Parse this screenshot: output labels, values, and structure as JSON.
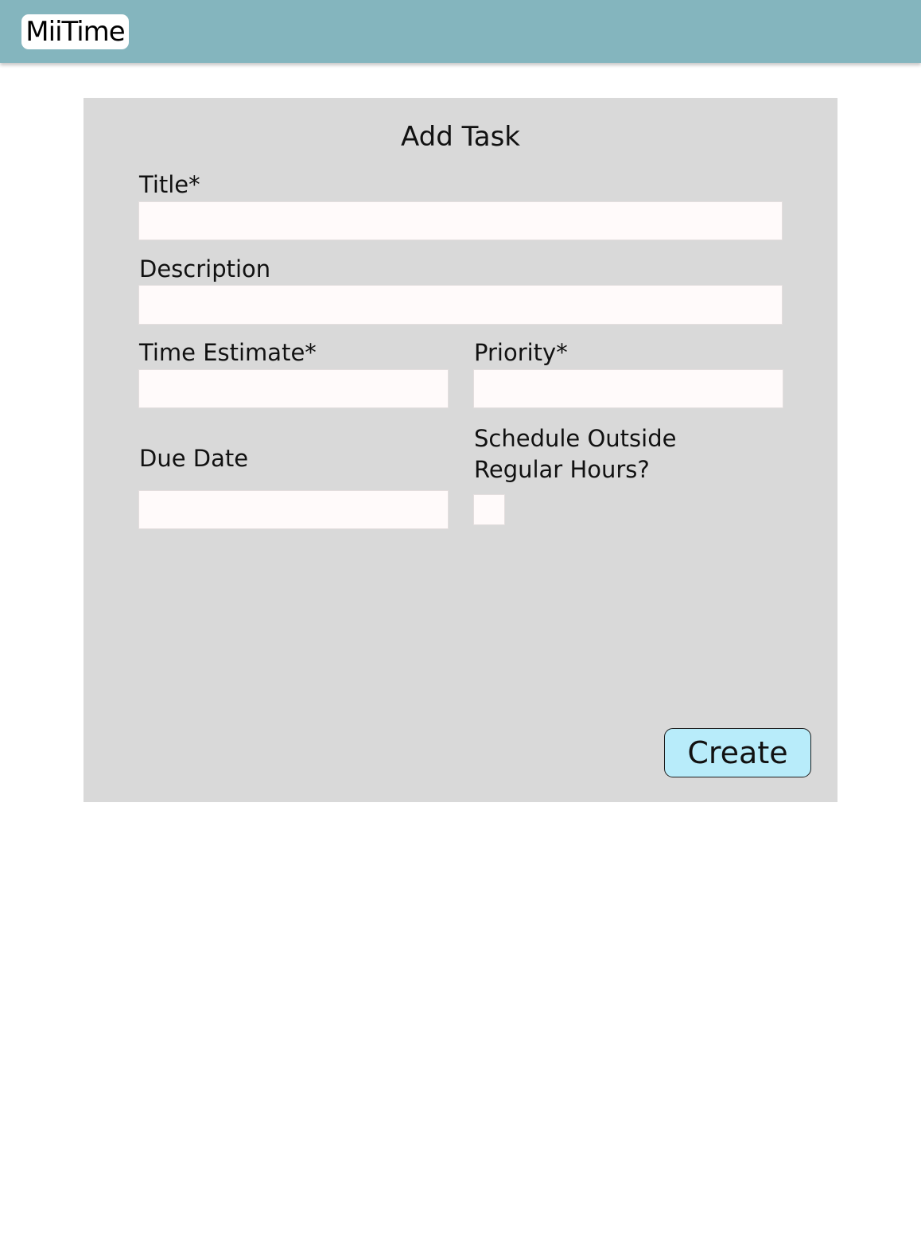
{
  "app": {
    "name": "MiiTime"
  },
  "form": {
    "heading": "Add Task",
    "fields": {
      "title": {
        "label": "Title*",
        "value": "",
        "placeholder": ""
      },
      "description": {
        "label": "Description",
        "value": "",
        "placeholder": ""
      },
      "time_estimate": {
        "label": "Time Estimate*",
        "value": "",
        "placeholder": ""
      },
      "priority": {
        "label": "Priority*",
        "value": "",
        "placeholder": ""
      },
      "due_date": {
        "label": "Due Date",
        "value": "",
        "placeholder": ""
      },
      "schedule_outside": {
        "label_line1": "Schedule Outside",
        "label_line2": "Regular Hours?",
        "checked": false
      }
    },
    "submit_label": "Create"
  },
  "colors": {
    "header": "#84b5be",
    "card": "#d9d9d9",
    "input": "#fffafa",
    "button": "#b8ecfa"
  }
}
